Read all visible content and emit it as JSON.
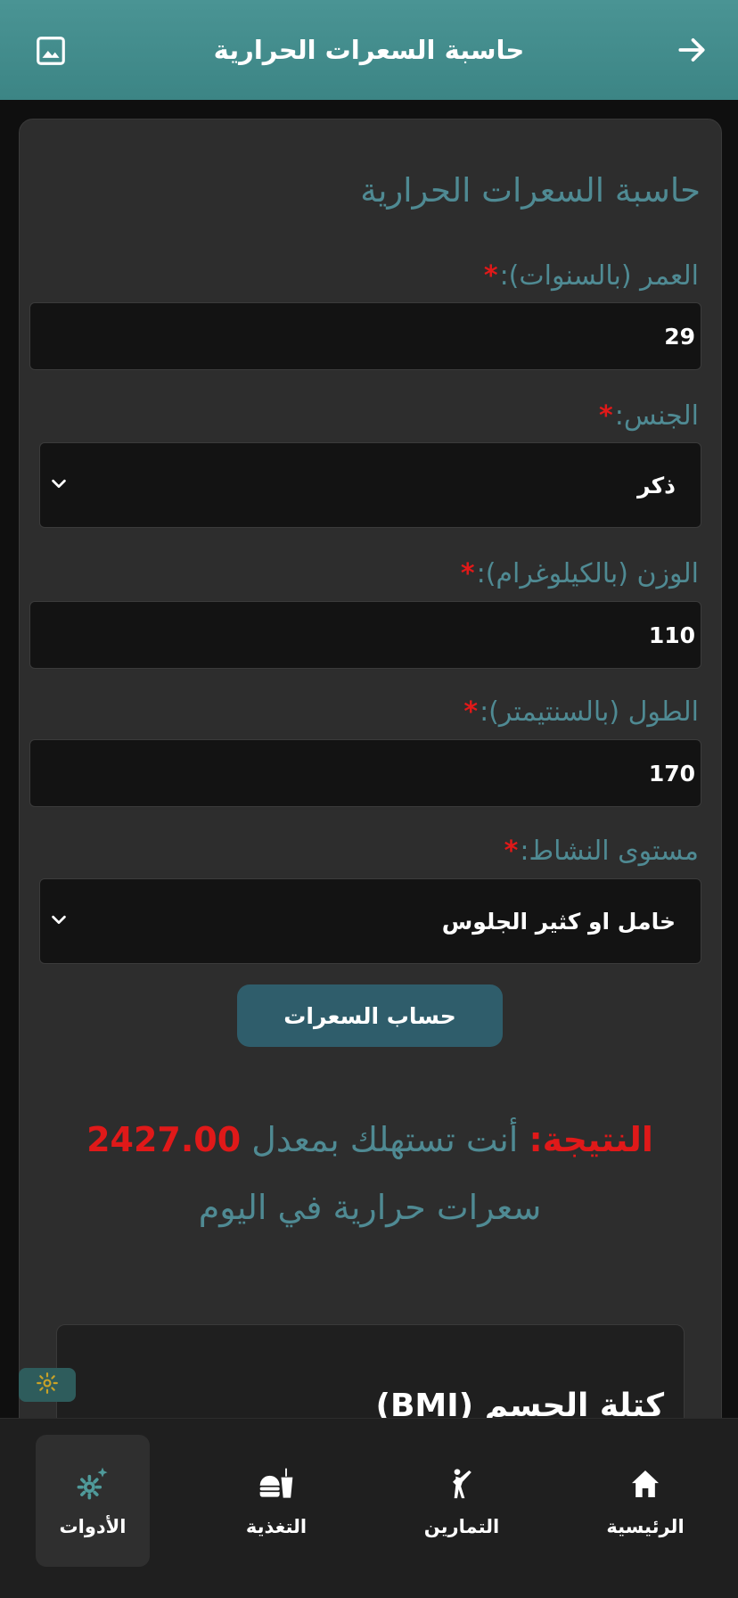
{
  "header": {
    "title": "حاسبة السعرات الحرارية",
    "back_icon": "arrow-right-icon",
    "image_icon": "image-icon"
  },
  "form": {
    "title": "حاسبة السعرات الحرارية",
    "required_mark": "*",
    "age": {
      "label": "العمر (بالسنوات):",
      "value": "29"
    },
    "gender": {
      "label": "الجنس:",
      "value": "ذكر"
    },
    "weight": {
      "label": "الوزن (بالكيلوغرام):",
      "value": "110"
    },
    "height": {
      "label": "الطول (بالسنتيمتر):",
      "value": "170"
    },
    "activity": {
      "label": "مستوى النشاط:",
      "value": "خامل او كثير الجلوس"
    },
    "calculate_button": "حساب السعرات"
  },
  "result": {
    "prefix": "النتيجة:",
    "text_before": " أنت تستهلك بمعدل ",
    "value": "2427.00",
    "text_after": "سعرات حرارية في اليوم"
  },
  "bmi_card": {
    "title": "كتلة الجسم (BMI)"
  },
  "colors": {
    "header_bg": "#4a9494",
    "accent_text": "#4f8a93",
    "required": "#e01919",
    "button_bg": "#2f5d6b"
  },
  "bottom_nav": {
    "items": [
      {
        "label": "الرئيسية",
        "icon": "home-icon"
      },
      {
        "label": "التمارين",
        "icon": "martial-arts-icon"
      },
      {
        "label": "التغذية",
        "icon": "food-icon"
      },
      {
        "label": "الأدوات",
        "icon": "tools-gear-icon",
        "active": true
      }
    ]
  }
}
